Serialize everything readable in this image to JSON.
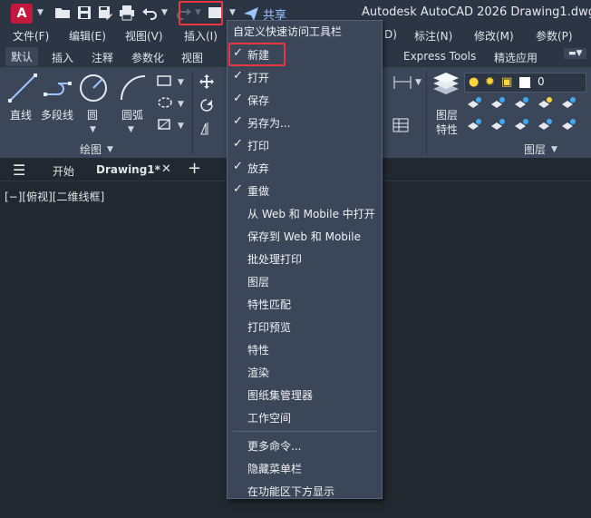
{
  "app": {
    "logo_letter": "A",
    "title": "Autodesk AutoCAD 2026    Drawing1.dwg",
    "share_label": "共享"
  },
  "menubar": {
    "items": [
      "文件(F)",
      "编辑(E)",
      "视图(V)",
      "插入(I)",
      "D)",
      "标注(N)",
      "修改(M)",
      "参数(P)"
    ]
  },
  "ribbon_tabs": {
    "items": [
      "默认",
      "插入",
      "注释",
      "参数化",
      "视图",
      "Express Tools",
      "精选应用"
    ]
  },
  "ribbon": {
    "draw_tools": [
      "直线",
      "多段线",
      "圆",
      "圆弧"
    ],
    "draw_panel_label": "绘图",
    "layer_tools": [
      "图层",
      "特性"
    ],
    "layer_panel_label": "图层",
    "layer_value": "0"
  },
  "filetabs": {
    "items": [
      "开始",
      "Drawing1*"
    ]
  },
  "viewport": {
    "label": "[−][俯视][二维线框]"
  },
  "dropdown": {
    "header": "自定义快速访问工具栏",
    "items": [
      {
        "label": "新建",
        "checked": true
      },
      {
        "label": "打开",
        "checked": true
      },
      {
        "label": "保存",
        "checked": true
      },
      {
        "label": "另存为...",
        "checked": true
      },
      {
        "label": "打印",
        "checked": true
      },
      {
        "label": "放弃",
        "checked": true
      },
      {
        "label": "重做",
        "checked": true
      },
      {
        "label": "从 Web 和 Mobile 中打开",
        "checked": false
      },
      {
        "label": "保存到 Web 和 Mobile",
        "checked": false
      },
      {
        "label": "批处理打印",
        "checked": false
      },
      {
        "label": "图层",
        "checked": false
      },
      {
        "label": "特性匹配",
        "checked": false
      },
      {
        "label": "打印预览",
        "checked": false
      },
      {
        "label": "特性",
        "checked": false
      },
      {
        "label": "渲染",
        "checked": false
      },
      {
        "label": "图纸集管理器",
        "checked": false
      },
      {
        "label": "工作空间",
        "checked": false
      }
    ],
    "footer_items": [
      "更多命令...",
      "隐藏菜单栏",
      "在功能区下方显示"
    ]
  }
}
